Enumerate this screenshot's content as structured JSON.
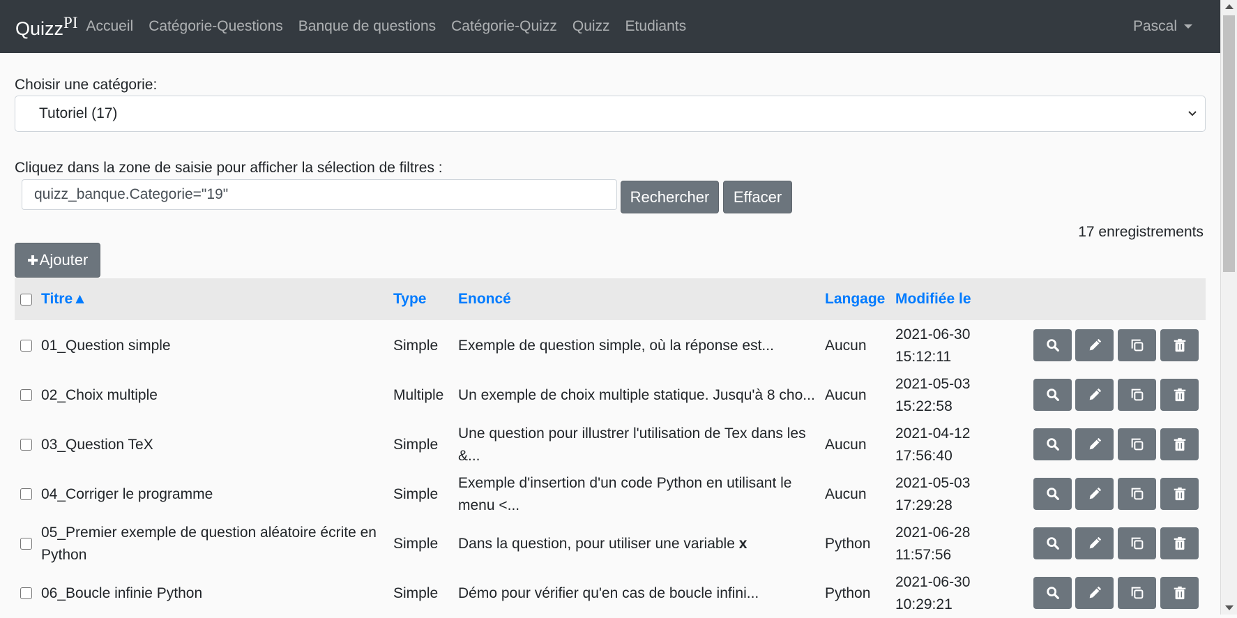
{
  "navbar": {
    "brand": "Quizz",
    "brand_sup": "PI",
    "links": [
      "Accueil",
      "Catégorie-Questions",
      "Banque de questions",
      "Catégorie-Quizz",
      "Quizz",
      "Etudiants"
    ],
    "user": "Pascal",
    "background": "#343a40"
  },
  "category": {
    "label": "Choisir une catégorie:",
    "selected": "Tutoriel (17)"
  },
  "filter": {
    "label": "Cliquez dans la zone de saisie pour afficher la sélection de filtres :",
    "value": "quizz_banque.Categorie=\"19\"",
    "search_button": "Rechercher",
    "clear_button": "Effacer"
  },
  "records_count": "17 enregistrements",
  "add_button": "Ajouter",
  "table": {
    "headers": {
      "title": "Titre",
      "sort_indicator": "▲",
      "type": "Type",
      "statement": "Enoncé",
      "language": "Langage",
      "modified": "Modifiée le"
    },
    "rows": [
      {
        "title": "01_Question simple",
        "type": "Simple",
        "statement": "Exemple de question simple, où la réponse est...",
        "language": "Aucun",
        "date": "2021-06-30",
        "time": "15:12:11"
      },
      {
        "title": "02_Choix multiple",
        "type": "Multiple",
        "statement": "Un exemple de choix multiple statique. Jusqu'à 8 cho...",
        "language": "Aucun",
        "date": "2021-05-03",
        "time": "15:22:58"
      },
      {
        "title": "03_Question TeX",
        "type": "Simple",
        "statement": "Une question pour illustrer l'utilisation de Tex dans les &...",
        "language": "Aucun",
        "date": "2021-04-12",
        "time": "17:56:40"
      },
      {
        "title": "04_Corriger le programme",
        "type": "Simple",
        "statement": "Exemple d'insertion d'un code Python en utilisant le menu <...",
        "language": "Aucun",
        "date": "2021-05-03",
        "time": "17:29:28"
      },
      {
        "title": "05_Premier exemple de question aléatoire écrite en Python",
        "type": "Simple",
        "statement": "Dans la question, pour utiliser une variable ",
        "statement_bold": "x",
        "language": "Python",
        "date": "2021-06-28",
        "time": "11:57:56"
      },
      {
        "title": "06_Boucle infinie Python",
        "type": "Simple",
        "statement": "Démo pour vérifier qu'en cas de boucle infini...",
        "language": "Python",
        "date": "2021-06-30",
        "time": "10:29:21"
      }
    ],
    "row_actions": [
      "search-icon",
      "pencil-icon",
      "copy-icon",
      "trash-icon"
    ]
  }
}
